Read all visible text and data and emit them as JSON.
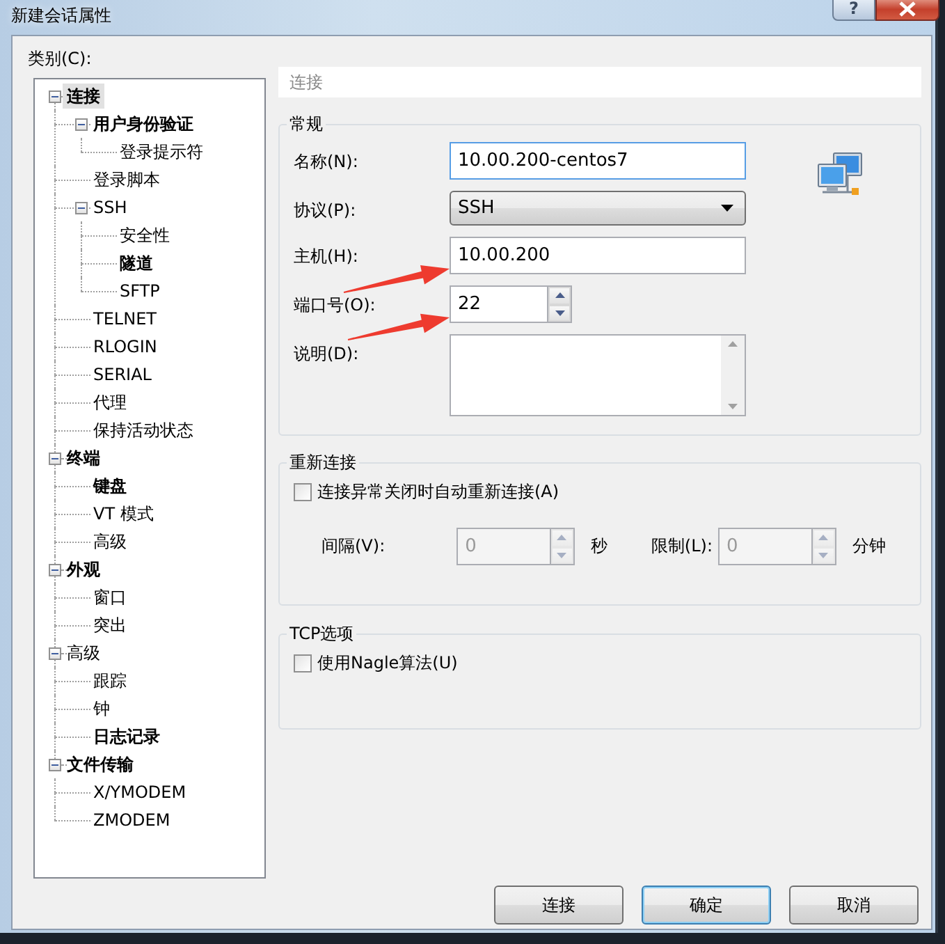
{
  "window": {
    "title": "新建会话属性",
    "help_glyph": "?"
  },
  "category_label": "类别(C):",
  "tree": [
    {
      "label": "连接",
      "bold": true,
      "selected": true,
      "expanded": true,
      "children": [
        {
          "label": "用户身份验证",
          "bold": true,
          "selected": false,
          "expanded": true,
          "children": [
            {
              "label": "登录提示符",
              "bold": false,
              "selected": false
            }
          ]
        },
        {
          "label": "登录脚本",
          "bold": false,
          "selected": false
        },
        {
          "label": "SSH",
          "bold": false,
          "selected": false,
          "expanded": true,
          "children": [
            {
              "label": "安全性",
              "bold": false,
              "selected": false
            },
            {
              "label": "隧道",
              "bold": true,
              "selected": false
            },
            {
              "label": "SFTP",
              "bold": false,
              "selected": false
            }
          ]
        },
        {
          "label": "TELNET",
          "bold": false,
          "selected": false
        },
        {
          "label": "RLOGIN",
          "bold": false,
          "selected": false
        },
        {
          "label": "SERIAL",
          "bold": false,
          "selected": false
        },
        {
          "label": "代理",
          "bold": false,
          "selected": false
        },
        {
          "label": "保持活动状态",
          "bold": false,
          "selected": false
        }
      ]
    },
    {
      "label": "终端",
      "bold": true,
      "selected": false,
      "expanded": true,
      "children": [
        {
          "label": "键盘",
          "bold": true,
          "selected": false
        },
        {
          "label": "VT 模式",
          "bold": false,
          "selected": false
        },
        {
          "label": "高级",
          "bold": false,
          "selected": false
        }
      ]
    },
    {
      "label": "外观",
      "bold": true,
      "selected": false,
      "expanded": true,
      "children": [
        {
          "label": "窗口",
          "bold": false,
          "selected": false
        },
        {
          "label": "突出",
          "bold": false,
          "selected": false
        }
      ]
    },
    {
      "label": "高级",
      "bold": false,
      "selected": false,
      "expanded": true,
      "children": [
        {
          "label": "跟踪",
          "bold": false,
          "selected": false
        },
        {
          "label": "钟",
          "bold": false,
          "selected": false
        },
        {
          "label": "日志记录",
          "bold": true,
          "selected": false
        }
      ]
    },
    {
      "label": "文件传输",
      "bold": true,
      "selected": false,
      "expanded": true,
      "children": [
        {
          "label": "X/YMODEM",
          "bold": false,
          "selected": false
        },
        {
          "label": "ZMODEM",
          "bold": false,
          "selected": false
        }
      ]
    }
  ],
  "panel_title": "连接",
  "general": {
    "title": "常规",
    "fields": [
      {
        "kind": "text",
        "label": "名称(N):",
        "value": "10.00.200-centos7"
      },
      {
        "kind": "select",
        "label": "协议(P):",
        "value": "SSH"
      },
      {
        "kind": "text",
        "label": "主机(H):",
        "value": "10.00.200"
      },
      {
        "kind": "spin",
        "label": "端口号(O):",
        "value": "22"
      },
      {
        "kind": "textarea",
        "label": "说明(D):"
      }
    ]
  },
  "reconnect": {
    "title": "重新连接",
    "checkbox": {
      "label": "连接异常关闭时自动重新连接(A)",
      "checked": false
    },
    "interval": {
      "label": "间隔(V):",
      "value": "0",
      "unit": "秒",
      "disabled": true
    },
    "limit": {
      "label": "限制(L):",
      "value": "0",
      "unit": "分钟",
      "disabled": true
    }
  },
  "tcp": {
    "title": "TCP选项",
    "checkbox": {
      "label": "使用Nagle算法(U)",
      "checked": false
    }
  },
  "buttons": [
    {
      "label": "连接",
      "default": false
    },
    {
      "label": "确定",
      "default": true
    },
    {
      "label": "取消",
      "default": false
    }
  ],
  "annotations": [
    {
      "kind": "arrow"
    },
    {
      "kind": "arrow"
    }
  ]
}
